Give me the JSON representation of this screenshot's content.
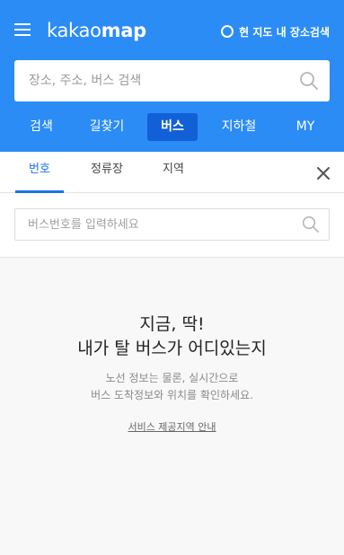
{
  "header": {
    "logo_light": "kakao",
    "logo_bold": "map",
    "map_search_label": "현 지도 내 장소검색",
    "brand_color": "#2b8cf5"
  },
  "search": {
    "placeholder": "장소, 주소, 버스 검색"
  },
  "main_tabs": [
    {
      "label": "검색"
    },
    {
      "label": "길찾기"
    },
    {
      "label": "버스",
      "active": true
    },
    {
      "label": "지하철"
    },
    {
      "label": "MY"
    }
  ],
  "sub_tabs": [
    {
      "label": "번호",
      "active": true
    },
    {
      "label": "정류장"
    },
    {
      "label": "지역"
    }
  ],
  "bus_search": {
    "placeholder": "버스번호를 입력하세요"
  },
  "empty_state": {
    "headline_line1": "지금, 딱!",
    "headline_line2": "내가 탈 버스가 어디있는지",
    "desc_line1": "노선 정보는 물론, 실시간으로",
    "desc_line2": "버스 도착정보와 위치를 확인하세요.",
    "link_label": "서비스 제공지역 안내"
  },
  "icons": [
    "menu-icon",
    "radio-icon",
    "search-icon",
    "close-icon"
  ]
}
